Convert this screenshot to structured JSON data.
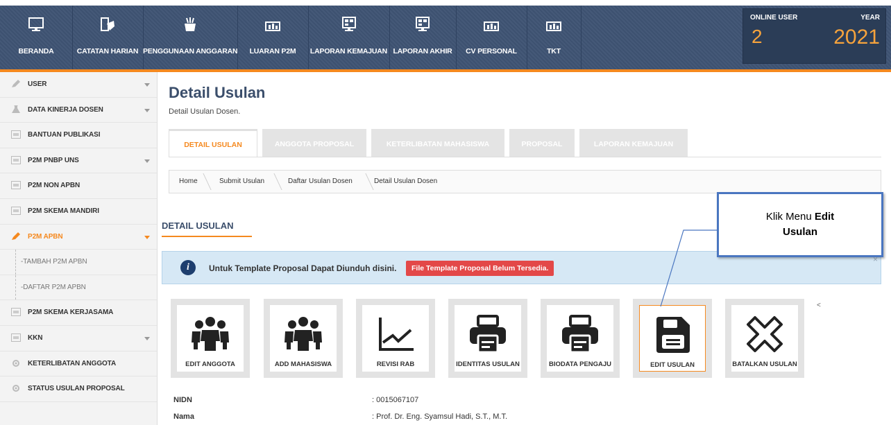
{
  "nav": {
    "items": [
      {
        "label": "BERANDA",
        "icon": "monitor-icon"
      },
      {
        "label": "CATATAN HARIAN",
        "icon": "notes-hand-icon"
      },
      {
        "label": "PENGGUNAAN ANGGARAN",
        "icon": "money-pot-icon"
      },
      {
        "label": "LUARAN P2M",
        "icon": "bar-chart-icon"
      },
      {
        "label": "LAPORAN KEMAJUAN",
        "icon": "report-monitor-icon"
      },
      {
        "label": "LAPORAN AKHIR",
        "icon": "report-monitor-icon"
      },
      {
        "label": "CV PERSONAL",
        "icon": "bar-chart-icon"
      },
      {
        "label": "TKT",
        "icon": "bar-chart-icon"
      }
    ],
    "online_label": "ONLINE USER",
    "online_value": "2",
    "year_label": "YEAR",
    "year_value": "2021"
  },
  "sidebar": {
    "items": [
      {
        "label": "USER",
        "icon": "pencil-icon",
        "caret": true
      },
      {
        "label": "DATA KINERJA DOSEN",
        "icon": "flask-icon",
        "caret": true
      },
      {
        "label": "BANTUAN PUBLIKASI",
        "icon": "screen-icon",
        "caret": false
      },
      {
        "label": "P2M PNBP UNS",
        "icon": "screen-icon",
        "caret": true
      },
      {
        "label": "P2M NON APBN",
        "icon": "screen-icon",
        "caret": false
      },
      {
        "label": "P2M SKEMA MANDIRI",
        "icon": "screen-icon",
        "caret": false
      },
      {
        "label": "P2M APBN",
        "icon": "pencil-icon",
        "caret": true,
        "active": true
      },
      {
        "label": "-TAMBAH P2M APBN",
        "sub": true
      },
      {
        "label": "-DAFTAR P2M APBN",
        "sub": true
      },
      {
        "label": "P2M SKEMA KERJASAMA",
        "icon": "screen-icon",
        "caret": false
      },
      {
        "label": "KKN",
        "icon": "screen-icon",
        "caret": true
      },
      {
        "label": "KETERLIBATAN ANGGOTA",
        "icon": "gear-icon",
        "caret": false
      },
      {
        "label": "STATUS USULAN PROPOSAL",
        "icon": "gear-icon",
        "caret": false
      }
    ]
  },
  "page": {
    "title": "Detail Usulan",
    "subtitle": "Detail Usulan Dosen."
  },
  "tabs": [
    "DETAIL USULAN",
    "ANGGOTA PROPOSAL",
    "KETERLIBATAN MAHASISWA",
    "PROPOSAL",
    "LAPORAN KEMAJUAN"
  ],
  "breadcrumb": [
    "Home",
    "Submit Usulan",
    "Daftar Usulan Dosen",
    "Detail Usulan Dosen"
  ],
  "section_title": "DETAIL USULAN",
  "info": {
    "text": "Untuk Template Proposal Dapat Diunduh disini.",
    "button": "File Template Proposal Belum Tersedia.",
    "close": "×"
  },
  "tiles": [
    {
      "label": "EDIT ANGGOTA",
      "icon": "group-icon"
    },
    {
      "label": "ADD MAHASISWA",
      "icon": "group-icon"
    },
    {
      "label": "REVISI RAB",
      "icon": "line-chart-icon"
    },
    {
      "label": "IDENTITAS USULAN",
      "icon": "printer-icon"
    },
    {
      "label": "BIODATA PENGAJU",
      "icon": "printer-icon"
    },
    {
      "label": "EDIT USULAN",
      "icon": "save-icon",
      "selected": true
    },
    {
      "label": "BATALKAN USULAN",
      "icon": "close-x-icon"
    }
  ],
  "stray": "<",
  "fields": [
    {
      "label": "NIDN",
      "value": ": 0015067107"
    },
    {
      "label": "Nama",
      "value": ": Prof. Dr. Eng. Syamsul Hadi, S.T., M.T."
    }
  ],
  "callout": {
    "text": "Klik Menu ",
    "bold1": "Edit",
    "bold2": "Usulan"
  }
}
